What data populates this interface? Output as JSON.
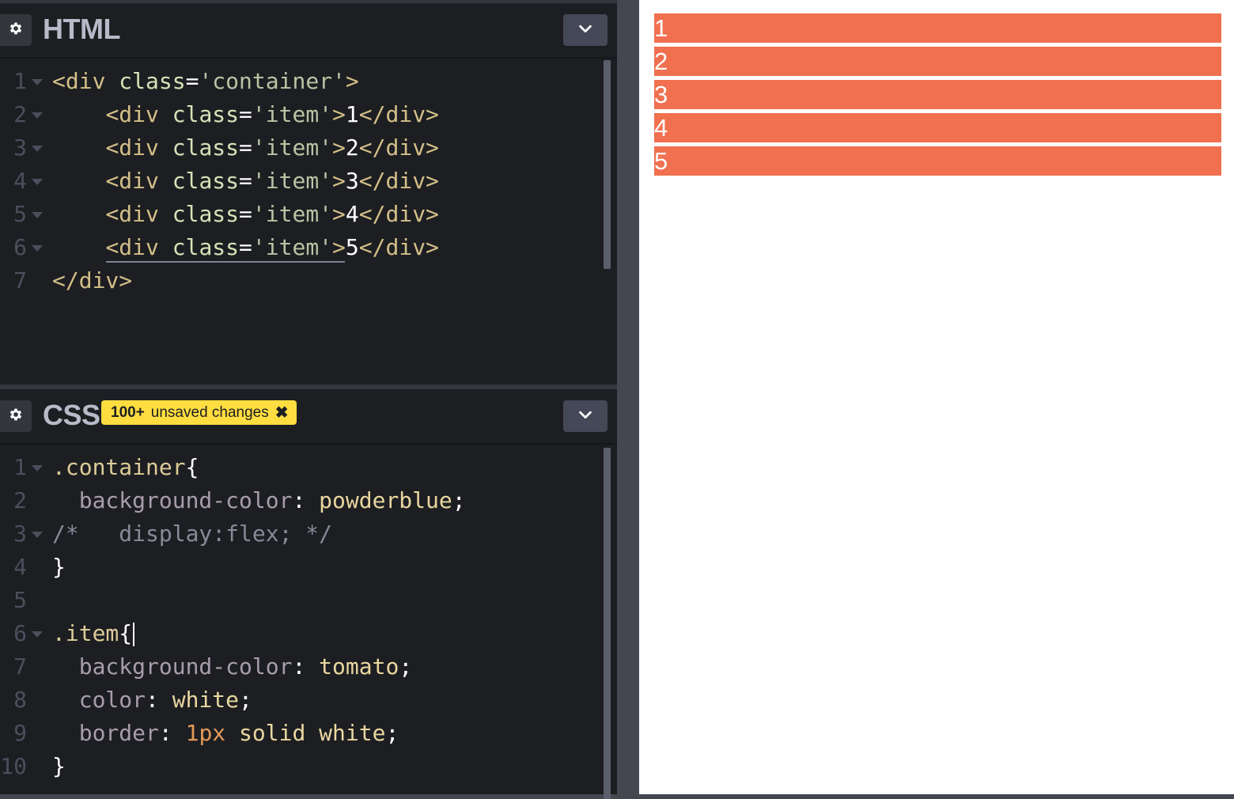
{
  "panes": {
    "html": {
      "title": "HTML",
      "lines": [
        {
          "num": "1",
          "foldable": true,
          "indent": "",
          "segments": [
            {
              "t": "<div ",
              "c": "tag"
            },
            {
              "t": "class",
              "c": "attr"
            },
            {
              "t": "=",
              "c": "plain"
            },
            {
              "t": "'container'",
              "c": "str"
            },
            {
              "t": ">",
              "c": "tag"
            }
          ]
        },
        {
          "num": "2",
          "foldable": true,
          "indent": "    ",
          "segments": [
            {
              "t": "<div ",
              "c": "tag"
            },
            {
              "t": "class",
              "c": "attr"
            },
            {
              "t": "=",
              "c": "plain"
            },
            {
              "t": "'item'",
              "c": "str"
            },
            {
              "t": ">",
              "c": "tag"
            },
            {
              "t": "1",
              "c": "plain"
            },
            {
              "t": "</div>",
              "c": "tag"
            }
          ]
        },
        {
          "num": "3",
          "foldable": true,
          "indent": "    ",
          "segments": [
            {
              "t": "<div ",
              "c": "tag"
            },
            {
              "t": "class",
              "c": "attr"
            },
            {
              "t": "=",
              "c": "plain"
            },
            {
              "t": "'item'",
              "c": "str"
            },
            {
              "t": ">",
              "c": "tag"
            },
            {
              "t": "2",
              "c": "plain"
            },
            {
              "t": "</div>",
              "c": "tag"
            }
          ]
        },
        {
          "num": "4",
          "foldable": true,
          "indent": "    ",
          "segments": [
            {
              "t": "<div ",
              "c": "tag"
            },
            {
              "t": "class",
              "c": "attr"
            },
            {
              "t": "=",
              "c": "plain"
            },
            {
              "t": "'item'",
              "c": "str"
            },
            {
              "t": ">",
              "c": "tag"
            },
            {
              "t": "3",
              "c": "plain"
            },
            {
              "t": "</div>",
              "c": "tag"
            }
          ]
        },
        {
          "num": "5",
          "foldable": true,
          "indent": "    ",
          "segments": [
            {
              "t": "<div ",
              "c": "tag"
            },
            {
              "t": "class",
              "c": "attr"
            },
            {
              "t": "=",
              "c": "plain"
            },
            {
              "t": "'item'",
              "c": "str"
            },
            {
              "t": ">",
              "c": "tag"
            },
            {
              "t": "4",
              "c": "plain"
            },
            {
              "t": "</div>",
              "c": "tag"
            }
          ]
        },
        {
          "num": "6",
          "foldable": true,
          "indent": "    ",
          "segments": [
            {
              "t": "<div ",
              "c": "tag"
            },
            {
              "t": "class",
              "c": "attr"
            },
            {
              "t": "=",
              "c": "plain"
            },
            {
              "t": "'item'",
              "c": "str"
            },
            {
              "t": ">",
              "c": "tag"
            },
            {
              "t": "5",
              "c": "plain"
            },
            {
              "t": "</div>",
              "c": "tag"
            }
          ]
        },
        {
          "num": "7",
          "foldable": false,
          "indent": "",
          "segments": [
            {
              "t": "</div>",
              "c": "tag"
            }
          ]
        }
      ]
    },
    "css": {
      "title": "CSS",
      "badge": {
        "count": "100+",
        "text": "unsaved changes",
        "close_icon": "✖"
      },
      "lines": [
        {
          "num": "1",
          "foldable": true,
          "indent": "",
          "segments": [
            {
              "t": ".container",
              "c": "sel"
            },
            {
              "t": "{",
              "c": "brace"
            }
          ]
        },
        {
          "num": "2",
          "foldable": false,
          "indent": "  ",
          "segments": [
            {
              "t": "background-color",
              "c": "prop"
            },
            {
              "t": ": ",
              "c": "plain"
            },
            {
              "t": "powderblue",
              "c": "val"
            },
            {
              "t": ";",
              "c": "plain"
            }
          ]
        },
        {
          "num": "3",
          "foldable": true,
          "indent": "",
          "segments": [
            {
              "t": "/*   display:flex; */",
              "c": "cmt"
            }
          ]
        },
        {
          "num": "4",
          "foldable": false,
          "indent": "",
          "segments": [
            {
              "t": "}",
              "c": "brace"
            }
          ]
        },
        {
          "num": "5",
          "foldable": false,
          "indent": "",
          "segments": []
        },
        {
          "num": "6",
          "foldable": true,
          "indent": "",
          "segments": [
            {
              "t": ".item",
              "c": "sel"
            },
            {
              "t": "{",
              "c": "brace"
            }
          ]
        },
        {
          "num": "7",
          "foldable": false,
          "indent": "  ",
          "segments": [
            {
              "t": "background-color",
              "c": "prop"
            },
            {
              "t": ": ",
              "c": "plain"
            },
            {
              "t": "tomato",
              "c": "val"
            },
            {
              "t": ";",
              "c": "plain"
            }
          ]
        },
        {
          "num": "8",
          "foldable": false,
          "indent": "  ",
          "segments": [
            {
              "t": "color",
              "c": "prop"
            },
            {
              "t": ": ",
              "c": "plain"
            },
            {
              "t": "white",
              "c": "val"
            },
            {
              "t": ";",
              "c": "plain"
            }
          ]
        },
        {
          "num": "9",
          "foldable": false,
          "indent": "  ",
          "segments": [
            {
              "t": "border",
              "c": "prop"
            },
            {
              "t": ": ",
              "c": "plain"
            },
            {
              "t": "1px",
              "c": "num-v"
            },
            {
              "t": " solid white",
              "c": "val"
            },
            {
              "t": ";",
              "c": "plain"
            }
          ]
        },
        {
          "num": "10",
          "foldable": false,
          "indent": "",
          "segments": [
            {
              "t": "}",
              "c": "brace"
            }
          ]
        }
      ]
    }
  },
  "preview": {
    "items": [
      "1",
      "2",
      "3",
      "4",
      "5"
    ]
  },
  "icons": {
    "settings": "gear-icon",
    "collapse": "chevron-down-icon",
    "badge_close": "close-icon"
  },
  "colors": {
    "item_bg": "#f0704f",
    "badge_bg": "#ffdd40",
    "editor_bg": "#1d1e22"
  }
}
